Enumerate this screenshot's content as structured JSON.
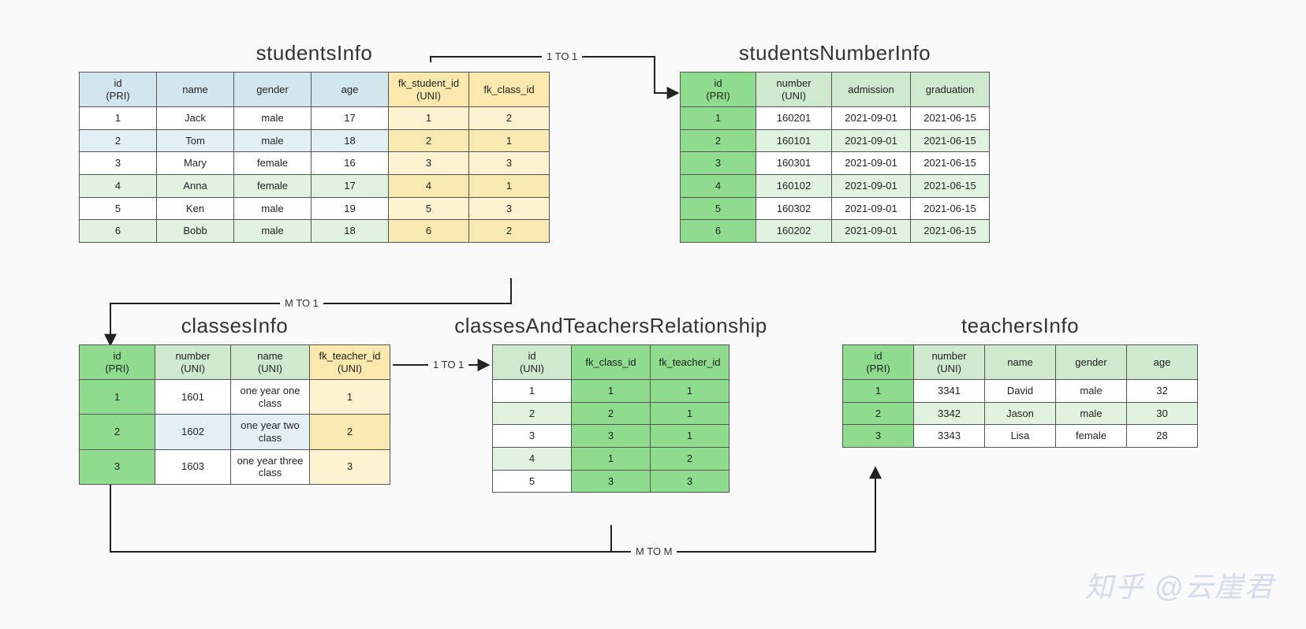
{
  "tables": {
    "studentsInfo": {
      "title": "studentsInfo",
      "headers": [
        "id\n(PRI)",
        "name",
        "gender",
        "age",
        "fk_student_id\n(UNI)",
        "fk_class_id"
      ],
      "rows": [
        [
          "1",
          "Jack",
          "male",
          "17",
          "1",
          "2"
        ],
        [
          "2",
          "Tom",
          "male",
          "18",
          "2",
          "1"
        ],
        [
          "3",
          "Mary",
          "female",
          "16",
          "3",
          "3"
        ],
        [
          "4",
          "Anna",
          "female",
          "17",
          "4",
          "1"
        ],
        [
          "5",
          "Ken",
          "male",
          "19",
          "5",
          "3"
        ],
        [
          "6",
          "Bobb",
          "male",
          "18",
          "6",
          "2"
        ]
      ]
    },
    "studentsNumberInfo": {
      "title": "studentsNumberInfo",
      "headers": [
        "id\n(PRI)",
        "number\n(UNI)",
        "admission",
        "graduation"
      ],
      "rows": [
        [
          "1",
          "160201",
          "2021-09-01",
          "2021-06-15"
        ],
        [
          "2",
          "160101",
          "2021-09-01",
          "2021-06-15"
        ],
        [
          "3",
          "160301",
          "2021-09-01",
          "2021-06-15"
        ],
        [
          "4",
          "160102",
          "2021-09-01",
          "2021-06-15"
        ],
        [
          "5",
          "160302",
          "2021-09-01",
          "2021-06-15"
        ],
        [
          "6",
          "160202",
          "2021-09-01",
          "2021-06-15"
        ]
      ]
    },
    "classesInfo": {
      "title": "classesInfo",
      "headers": [
        "id\n(PRI)",
        "number\n(UNI)",
        "name\n(UNI)",
        "fk_teacher_id\n(UNI)"
      ],
      "rows": [
        [
          "1",
          "1601",
          "one year one class",
          "1"
        ],
        [
          "2",
          "1602",
          "one year two class",
          "2"
        ],
        [
          "3",
          "1603",
          "one year three class",
          "3"
        ]
      ]
    },
    "classesAndTeachersRelationship": {
      "title": "classesAndTeachersRelationship",
      "headers": [
        "id\n(UNI)",
        "fk_class_id",
        "fk_teacher_id"
      ],
      "rows": [
        [
          "1",
          "1",
          "1"
        ],
        [
          "2",
          "2",
          "1"
        ],
        [
          "3",
          "3",
          "1"
        ],
        [
          "4",
          "1",
          "2"
        ],
        [
          "5",
          "3",
          "3"
        ]
      ]
    },
    "teachersInfo": {
      "title": "teachersInfo",
      "headers": [
        "id\n(PRI)",
        "number\n(UNI)",
        "name",
        "gender",
        "age"
      ],
      "rows": [
        [
          "1",
          "3341",
          "David",
          "male",
          "32"
        ],
        [
          "2",
          "3342",
          "Jason",
          "male",
          "30"
        ],
        [
          "3",
          "3343",
          "Lisa",
          "female",
          "28"
        ]
      ]
    }
  },
  "relationships": {
    "r1": "1 TO 1",
    "r2": "M TO 1",
    "r3": "1 TO 1",
    "r4": "M TO M"
  },
  "watermark": "知乎 @云崖君"
}
